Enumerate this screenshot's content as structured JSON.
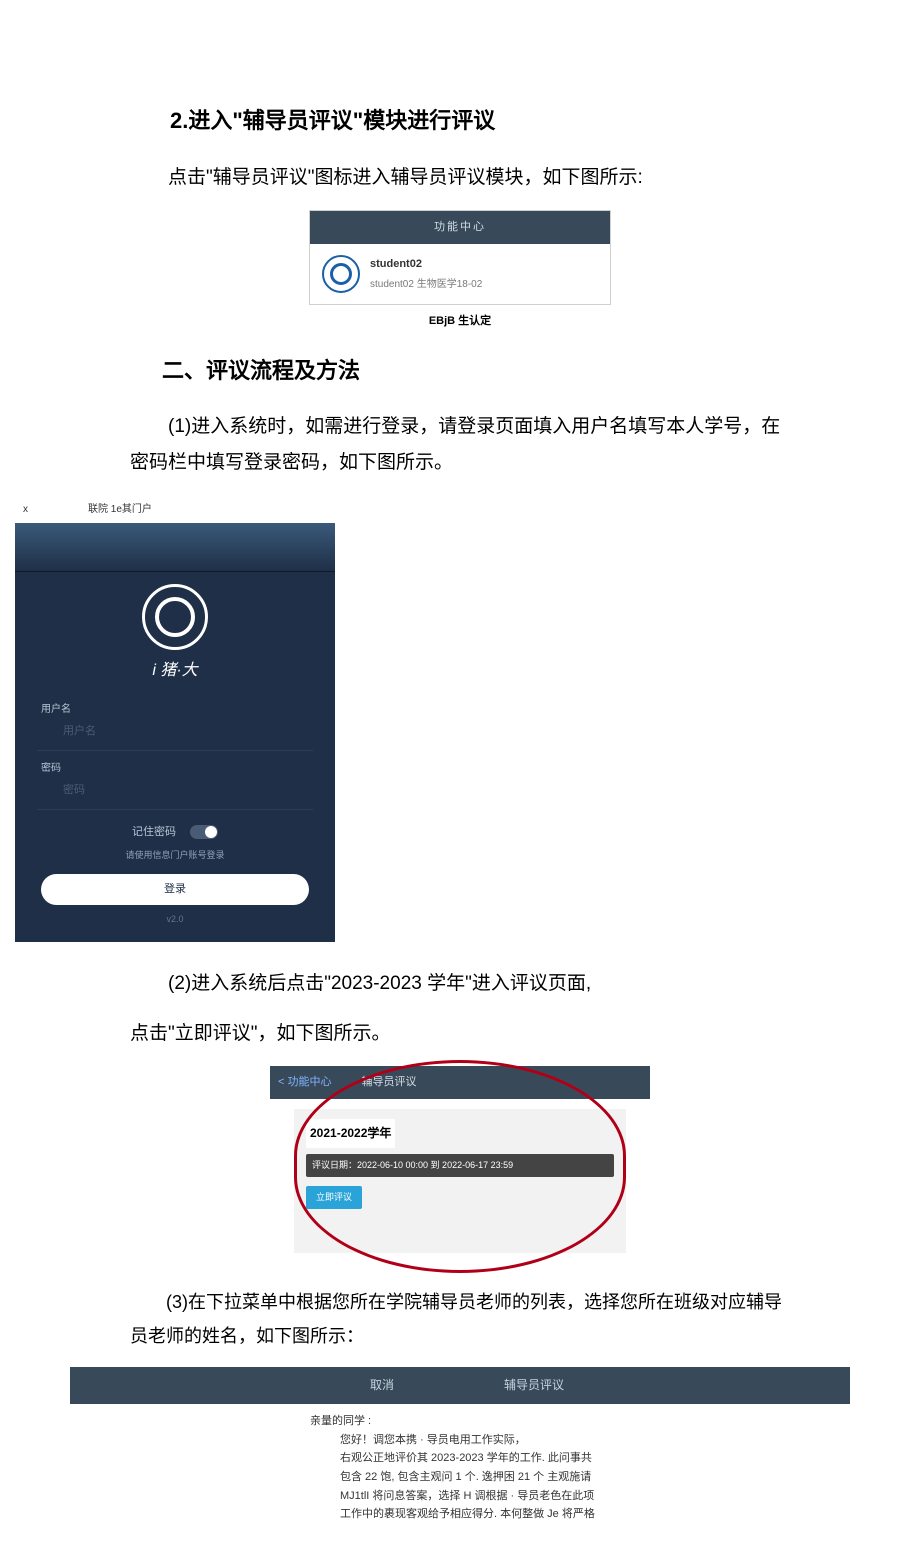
{
  "section2": {
    "title": "2.进入\"辅导员评议\"模块进行评议",
    "p1": "点击\"辅导员评议\"图标进入辅导员评议模块，如下图所示:"
  },
  "fig1": {
    "header": "功能中心",
    "username": "student02",
    "userline": "student02 生物医学18-02",
    "caption": "EBjB 生认定"
  },
  "section3": {
    "title": "二、评议流程及方法",
    "p1": "(1)进入系统时，如需进行登录，请登录页面填入用户名填写本人学号，在密码栏中填写登录密码，如下图所示。"
  },
  "login": {
    "x": "x",
    "tab": "联院 1e其门户",
    "brand": "i 猪·大",
    "user_label": "用户名",
    "user_ph": "用户名",
    "pwd_label": "密码",
    "pwd_ph": "密码",
    "remember": "记住密码",
    "hint": "请使用信息门户账号登录",
    "login_btn": "登录",
    "version": "v2.0"
  },
  "step2": {
    "text_a": "(2)进入系统后点击\"2023-2023 学年\"进入评议页面,",
    "text_b": "点击\"立即评议\"，如下图所示。"
  },
  "fig3": {
    "back": "< 功能中心",
    "title": "辅导员评议",
    "year": "2021-2022学年",
    "date": "评议日期：2022-06-10 00:00 到 2022-06-17 23:59",
    "btn": "立即评议"
  },
  "step3": {
    "text": "(3)在下拉菜单中根据您所在学院辅导员老师的列表，选择您所在班级对应辅导员老师的姓名，如下图所示："
  },
  "fig4": {
    "cancel": "取消",
    "title": "辅导员评议",
    "l1": "亲量的同学 :",
    "l2": "您好！调您本携 · 导员电用工作实际，",
    "l3": "右观公正地评价其 2023-2023 学年的工作. 此问事共",
    "l4": "包含 22 饱, 包含主观问 1 个. 逸押困 21 个 主观施请",
    "l5": "MJ1tlI 将问息答案，选择 H 调根据 · 导员老色在此项",
    "l6": "工作中的裹现客观给予相应得分. 本何整做 Je 将严格"
  }
}
